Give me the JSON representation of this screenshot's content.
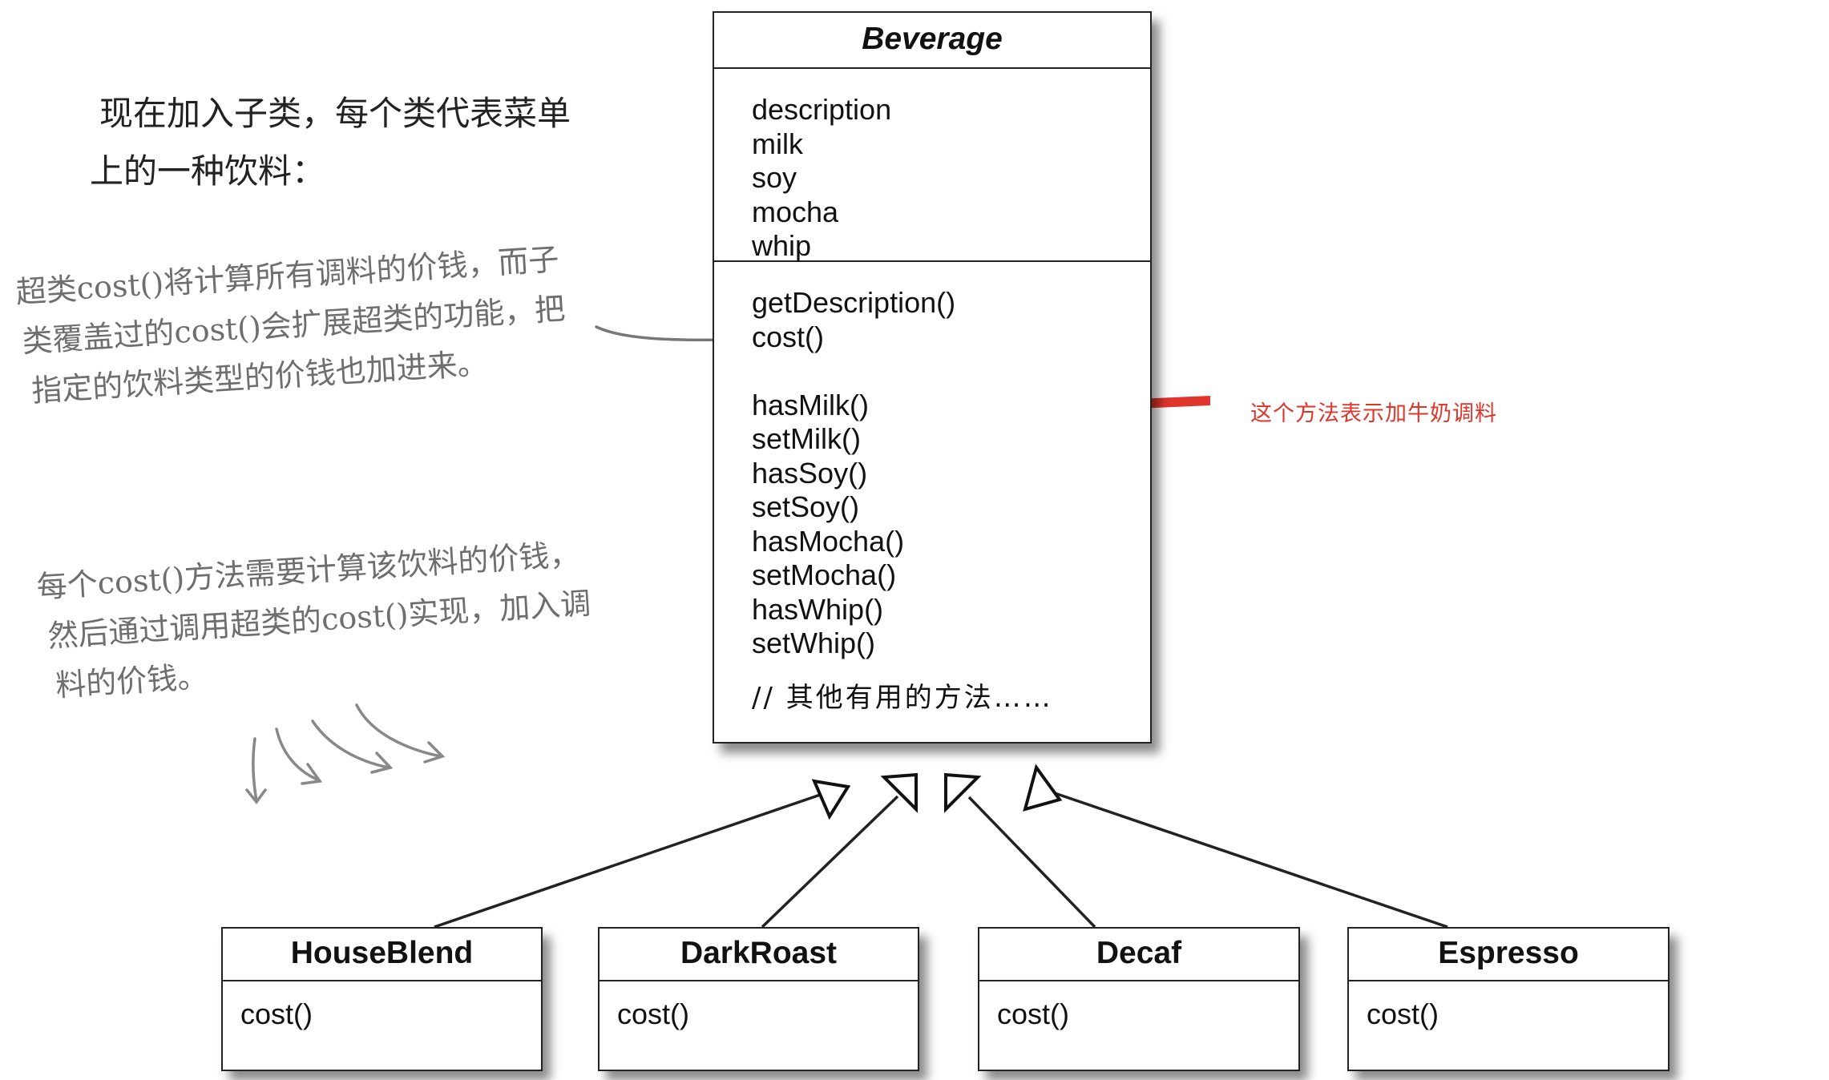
{
  "intro_note": {
    "lines": [
      "现在加入子类，每个类代表菜单",
      "上的一种饮料："
    ]
  },
  "superclass_note": {
    "lines": [
      "超类cost()将计算所有调料的价钱，而子",
      "类覆盖过的cost()会扩展超类的功能，把",
      "指定的饮料类型的价钱也加进来。"
    ]
  },
  "subclass_note": {
    "lines": [
      "每个cost()方法需要计算该饮料的价钱，",
      "然后通过调用超类的cost()实现，加入调",
      "料的价钱。"
    ]
  },
  "red_note": "这个方法表示加牛奶调料",
  "beverage": {
    "name": "Beverage",
    "attributes": [
      "description",
      "milk",
      "soy",
      "mocha",
      "whip"
    ],
    "methods_top": [
      "getDescription()",
      "cost()"
    ],
    "methods_condiments": [
      "hasMilk()",
      "setMilk()",
      "hasSoy()",
      "setSoy()",
      "hasMocha()",
      "setMocha()",
      "hasWhip()",
      "setWhip()"
    ],
    "comment": "// 其他有用的方法……"
  },
  "subclasses": [
    {
      "name": "HouseBlend",
      "method": "cost()"
    },
    {
      "name": "DarkRoast",
      "method": "cost()"
    },
    {
      "name": "Decaf",
      "method": "cost()"
    },
    {
      "name": "Espresso",
      "method": "cost()"
    }
  ],
  "colors": {
    "outline": "#222222",
    "note_gray": "#6e6e6e",
    "highlight_red": "#e0352b"
  }
}
